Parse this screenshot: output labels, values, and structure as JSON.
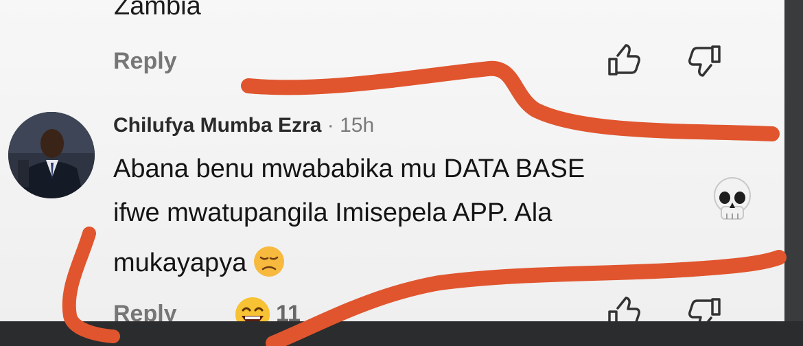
{
  "previous_comment": {
    "text_tail": "Zambia",
    "reply_label": "Reply"
  },
  "comment": {
    "author": "Chilufya Mumba Ezra",
    "separator": "·",
    "time": "15h",
    "lines": [
      "Abana benu mwababika mu DATA BASE",
      "ifwe mwatupangila Imisepela APP. Ala",
      "mukayapya"
    ],
    "reply_label": "Reply",
    "reaction_count": "11",
    "reaction_icon": "laughing-face",
    "inline_emoji": "unamused-face",
    "side_emoji": "skull"
  },
  "colors": {
    "scribble": "#e0552e",
    "text_primary": "#141414",
    "text_secondary": "#767676"
  }
}
